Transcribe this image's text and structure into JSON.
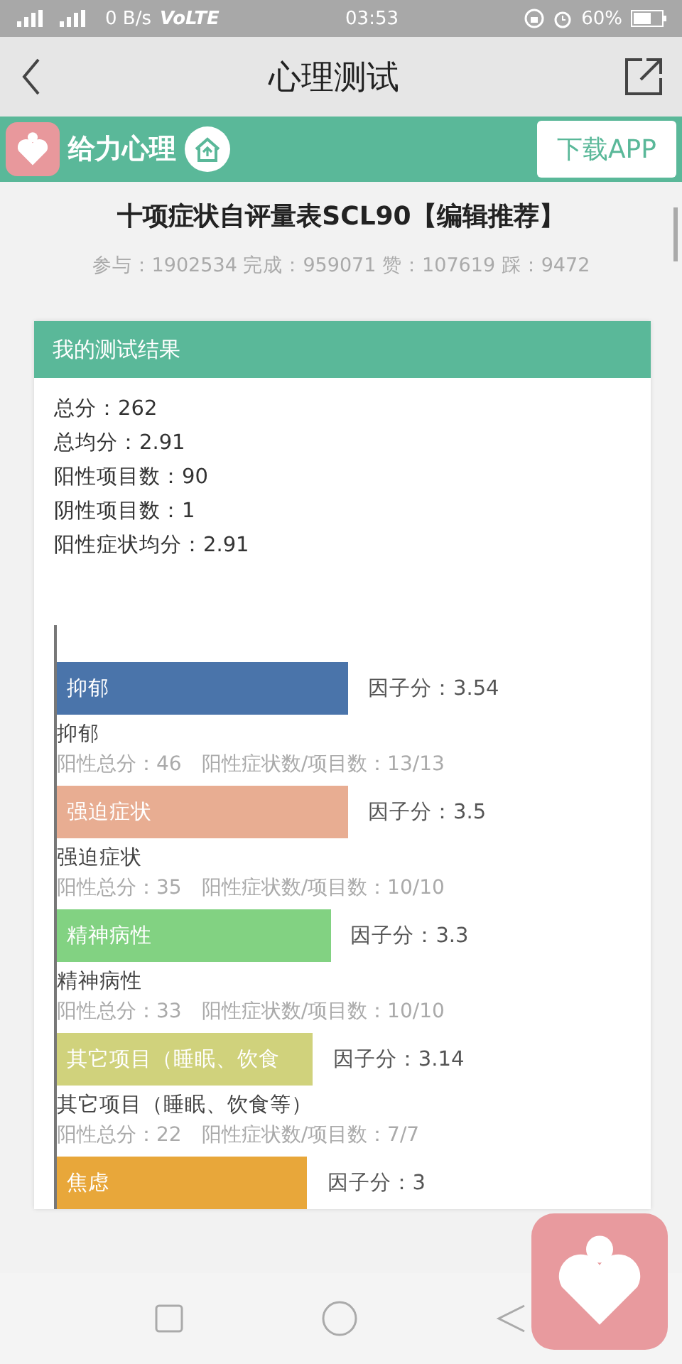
{
  "status_bar": {
    "speed": "0 B/s",
    "network": "VoLTE",
    "time": "03:53",
    "battery": "60%"
  },
  "nav": {
    "title": "心理测试"
  },
  "banner": {
    "brand": "给力心理",
    "download": "下载APP"
  },
  "test": {
    "title": "十项症状自评量表SCL90【编辑推荐】",
    "stats": "参与：1902534 完成：959071 赞：107619 踩：9472"
  },
  "result": {
    "header": "我的测试结果",
    "summary": [
      "总分：262",
      "总均分：2.91",
      "阳性项目数：90",
      "阴性项目数：1",
      "阳性症状均分：2.91"
    ],
    "factors": [
      {
        "bar_label": "抑郁",
        "color": "#4a74aa",
        "level": 0.5,
        "score": "因子分：3.54",
        "name": "抑郁",
        "detail": "阳性总分：46　阳性症状数/项目数：13/13"
      },
      {
        "bar_label": "强迫症状",
        "color": "#e8ad92",
        "level": 0.5,
        "score": "因子分：3.5",
        "name": "强迫症状",
        "detail": "阳性总分：35　阳性症状数/项目数：10/10"
      },
      {
        "bar_label": "精神病性",
        "color": "#82d282",
        "level": 0.47,
        "score": "因子分：3.3",
        "name": "精神病性",
        "detail": "阳性总分：33　阳性症状数/项目数：10/10"
      },
      {
        "bar_label": "其它项目（睡眠、饮食",
        "color": "#d0d27c",
        "level": 0.44,
        "score": "因子分：3.14",
        "name": "其它项目（睡眠、饮食等）",
        "detail": "阳性总分：22　阳性症状数/项目数：7/7"
      },
      {
        "bar_label": "焦虑",
        "color": "#e8a73a",
        "level": 0.43,
        "score": "因子分：3"
      }
    ]
  }
}
